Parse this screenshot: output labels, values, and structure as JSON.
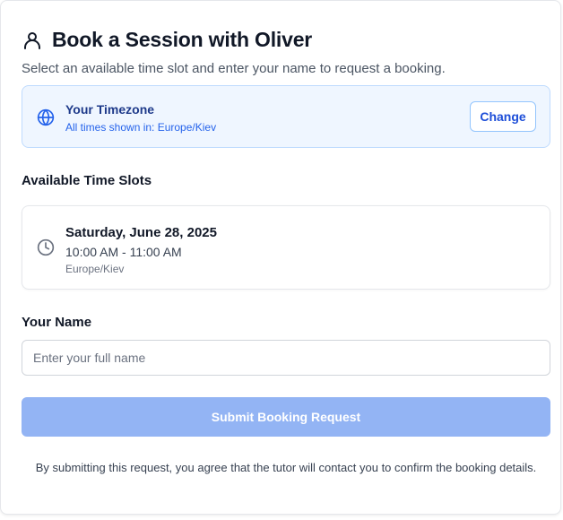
{
  "header": {
    "title": "Book a Session with Oliver",
    "subtitle": "Select an available time slot and enter your name to request a booking.",
    "icon": "user-icon"
  },
  "timezone": {
    "title": "Your Timezone",
    "description": "All times shown in: Europe/Kiev",
    "change_label": "Change",
    "icon": "globe-icon"
  },
  "slots": {
    "heading": "Available Time Slots",
    "items": [
      {
        "date": "Saturday, June 28, 2025",
        "time": "10:00 AM - 11:00 AM",
        "timezone": "Europe/Kiev",
        "icon": "clock-icon"
      }
    ]
  },
  "name": {
    "label": "Your Name",
    "placeholder": "Enter your full name",
    "value": ""
  },
  "submit": {
    "label": "Submit Booking Request",
    "disabled": true
  },
  "disclaimer": "By submitting this request, you agree that the tutor will contact you to confirm the booking details.",
  "colors": {
    "accent": "#2563eb",
    "info_bg": "#eff6ff",
    "info_border": "#bfdbfe",
    "button_disabled": "#93b4f4"
  }
}
